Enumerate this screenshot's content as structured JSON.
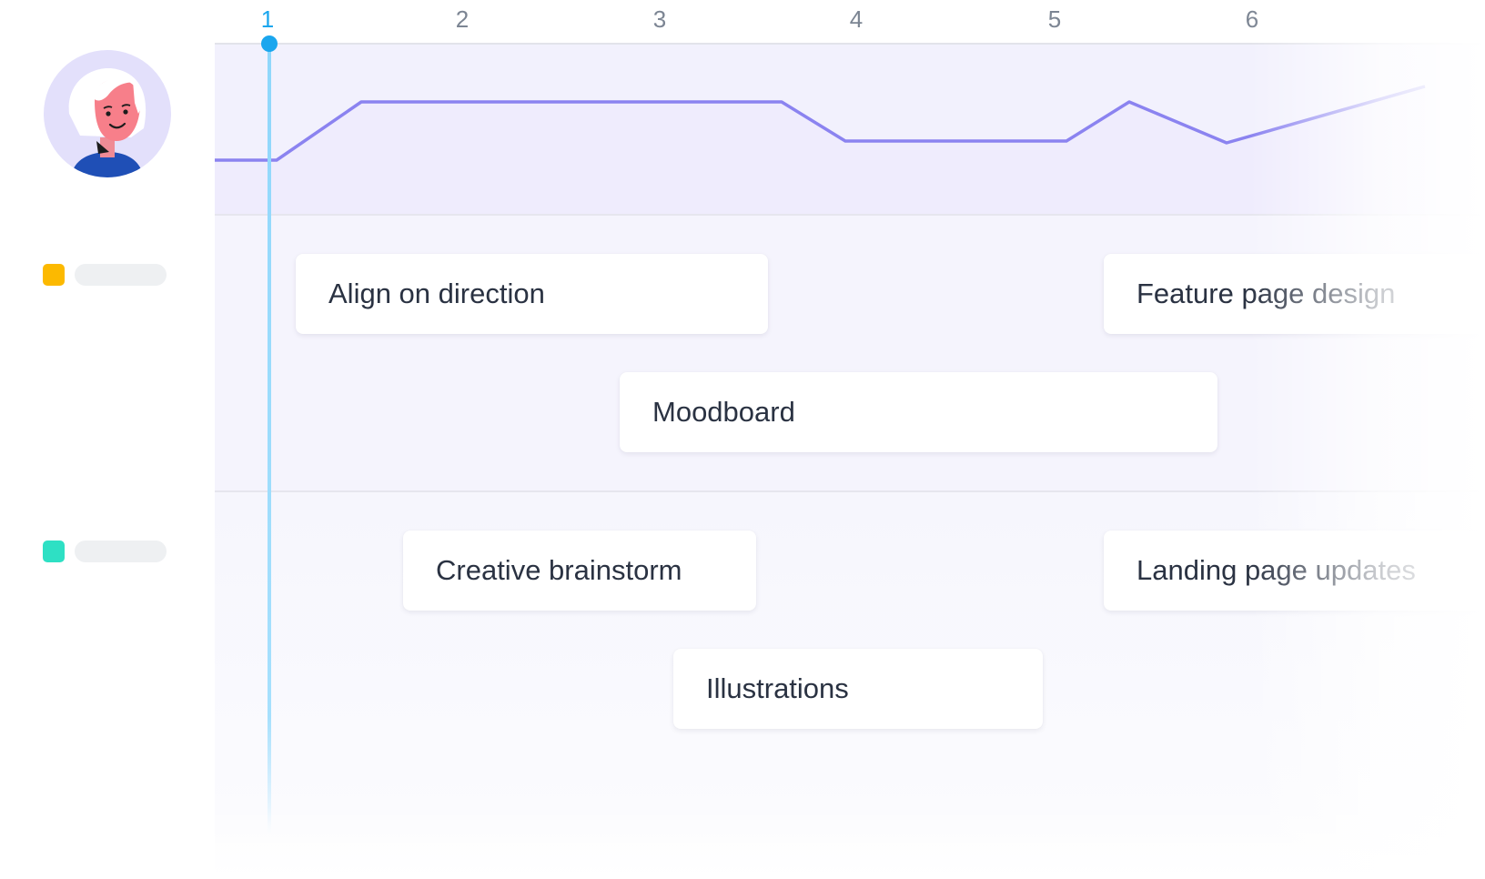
{
  "weeks": [
    {
      "label": "1",
      "current": true
    },
    {
      "label": "2"
    },
    {
      "label": "3"
    },
    {
      "label": "4"
    },
    {
      "label": "5"
    },
    {
      "label": "6"
    }
  ],
  "workload": {
    "line_color": "#8b83f0",
    "fill_color": "#eceafd"
  },
  "groups": [
    {
      "marker_color": "#fcb900"
    },
    {
      "marker_color": "#2ee0c4"
    }
  ],
  "tasks": [
    {
      "label": "Align on direction",
      "group": 0
    },
    {
      "label": "Feature page design",
      "group": 0
    },
    {
      "label": "Moodboard",
      "group": 0
    },
    {
      "label": "Creative brainstorm",
      "group": 1
    },
    {
      "label": "Landing page updates",
      "group": 1
    },
    {
      "label": "Illustrations",
      "group": 1
    }
  ],
  "colors": {
    "accent": "#1aa6ee",
    "text": "#2a3242",
    "muted": "#7c8593"
  }
}
